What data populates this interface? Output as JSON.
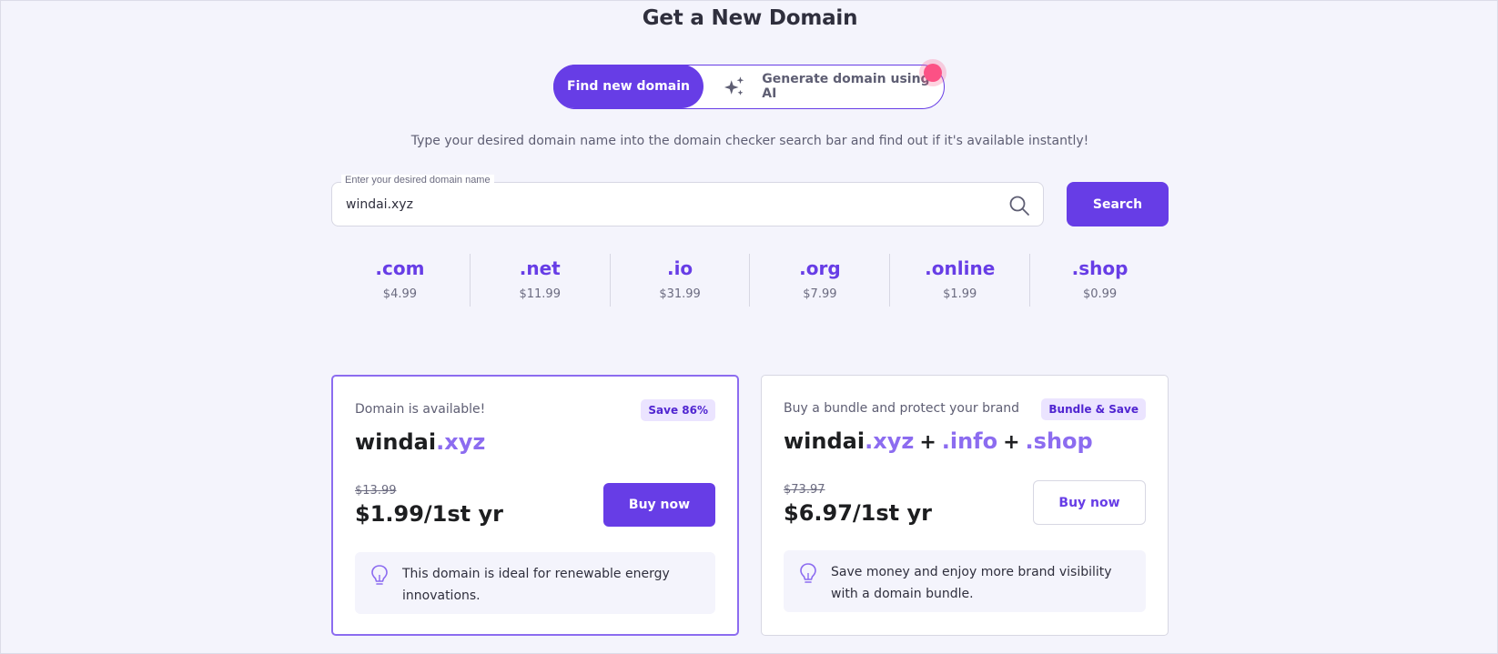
{
  "page": {
    "title": "Get a New Domain",
    "subtitle": "Type your desired domain name into the domain checker search bar and find out if it's available instantly!"
  },
  "toggle": {
    "active_label": "Find new domain",
    "ai_label": "Generate domain using AI",
    "ai_icon": "sparkle-icon"
  },
  "search": {
    "label": "Enter your desired domain name",
    "value": "windai.xyz",
    "button_label": "Search"
  },
  "tlds": [
    {
      "name": ".com",
      "price": "$4.99"
    },
    {
      "name": ".net",
      "price": "$11.99"
    },
    {
      "name": ".io",
      "price": "$31.99"
    },
    {
      "name": ".org",
      "price": "$7.99"
    },
    {
      "name": ".online",
      "price": "$1.99"
    },
    {
      "name": ".shop",
      "price": "$0.99"
    }
  ],
  "available_card": {
    "status": "Domain is available!",
    "badge": "Save 86%",
    "domain_name": "windai",
    "domain_tld": ".xyz",
    "old_price": "$13.99",
    "new_price": "$1.99/1st yr",
    "button_label": "Buy now",
    "tip": "This domain is ideal for renewable energy innovations."
  },
  "bundle_card": {
    "status": "Buy a bundle and protect your brand",
    "badge": "Bundle & Save",
    "domain_name": "windai",
    "tld_1": ".xyz",
    "plus_1": "+",
    "tld_2": ".info",
    "plus_2": "+",
    "tld_3": ".shop",
    "old_price": "$73.97",
    "new_price": "$6.97/1st yr",
    "button_label": "Buy now",
    "tip": "Save money and enjoy more brand visibility with a domain bundle."
  },
  "colors": {
    "brand": "#673de6",
    "accent_light": "#8c6cf0",
    "badge_bg": "#ebe4ff",
    "notification": "#fc5185",
    "background": "#f4f4fc"
  }
}
